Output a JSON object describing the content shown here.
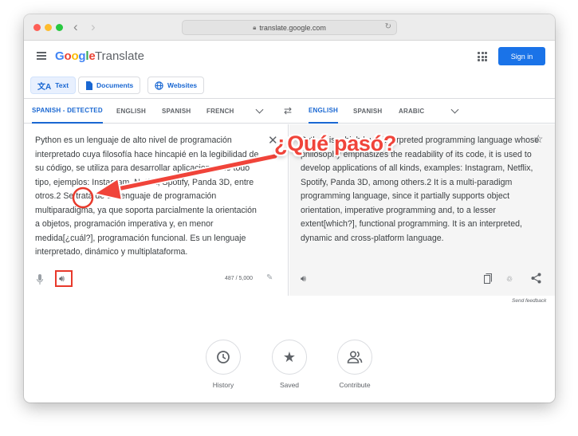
{
  "browser": {
    "url": "translate.google.com"
  },
  "header": {
    "logo_google": "Google",
    "logo_product": "Translate",
    "signin_label": "Sign in"
  },
  "modes": {
    "text": "Text",
    "documents": "Documents",
    "websites": "Websites"
  },
  "source_langs": [
    "SPANISH - DETECTED",
    "ENGLISH",
    "SPANISH",
    "FRENCH"
  ],
  "target_langs": [
    "ENGLISH",
    "SPANISH",
    "ARABIC"
  ],
  "source": {
    "text": "Python es un lenguaje de alto nivel de programación interpretado cuya filosofía hace hincapié en la legibilidad de su código, se utiliza para desarrollar aplicaciones de todo tipo, ejemplos: Instagram, Netflix, Spotify, Panda 3D, entre otros.2 Se trata de un lenguaje de programación multiparadigma, ya que soporta parcialmente la orientación a objetos, programación imperativa y, en menor medida[¿cuál?], programación funcional. Es un lenguaje interpretado, dinámico y multiplataforma.",
    "char_count": "487 / 5,000"
  },
  "target": {
    "text": "Python is a high level interpreted programming language whose philosophy emphasizes the readability of its code, it is used to develop applications of all kinds, examples: Instagram, Netflix, Spotify, Panda 3D, among others.2 It is a multi-paradigm programming language, since it partially supports object orientation, imperative programming and, to a lesser extent[which?], functional programming. It is an interpreted, dynamic and cross-platform language."
  },
  "send_feedback": "Send feedback",
  "shortcuts": {
    "history": "History",
    "saved": "Saved",
    "contribute": "Contribute"
  },
  "annotation": {
    "text": "¿Qué pasó?",
    "color": "#f0443a"
  },
  "colors": {
    "accent": "#1a73e8",
    "annotation_red": "#e8392b"
  }
}
